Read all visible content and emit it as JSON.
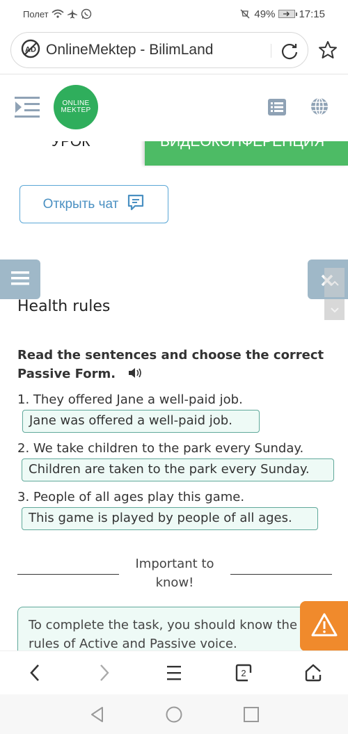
{
  "status_bar": {
    "carrier": "Полет",
    "icons_left": [
      "wifi-icon",
      "airplane-icon",
      "whatsapp-icon"
    ],
    "icons_right": [
      "mute-icon",
      "battery-icon"
    ],
    "battery": "49%",
    "time": "17:15"
  },
  "browser": {
    "page_title": "OnlineMektep - BilimLand",
    "adblock_icon": "adblock-icon",
    "tab_count": "2"
  },
  "site_header": {
    "logo_line1": "ONLINE",
    "logo_line2": "MEKTEP"
  },
  "tabs": {
    "lesson": "УРОК",
    "video": "ВИДЕОКОНФЕРЕНЦИЯ"
  },
  "chat": {
    "label": "Открыть чат"
  },
  "lesson": {
    "title": "Health rules",
    "instruction": "Read the sentences and choose the correct Passive Form.",
    "questions": [
      {
        "text": "1. They offered Jane a well-paid job.",
        "answer": "Jane was offered a well-paid job."
      },
      {
        "text": "2. We take children to the park every Sunday.",
        "answer": "Children are taken to the park every Sunday."
      },
      {
        "text": "3. People of all ages play this game.",
        "answer": "This game is played by people of all ages."
      }
    ],
    "important_label": "Important to know!",
    "info_line1": "To complete the task, you should know the",
    "info_line2": "rules of Active and Passive voice."
  },
  "colors": {
    "brand_green": "#2fae5c",
    "video_green": "#4dbb65",
    "chat_blue": "#4a90c2",
    "answer_border": "#5fa89a",
    "answer_bg": "#eefaf6",
    "side_button": "#9fb8c8",
    "warning_orange": "#f08a2c"
  }
}
